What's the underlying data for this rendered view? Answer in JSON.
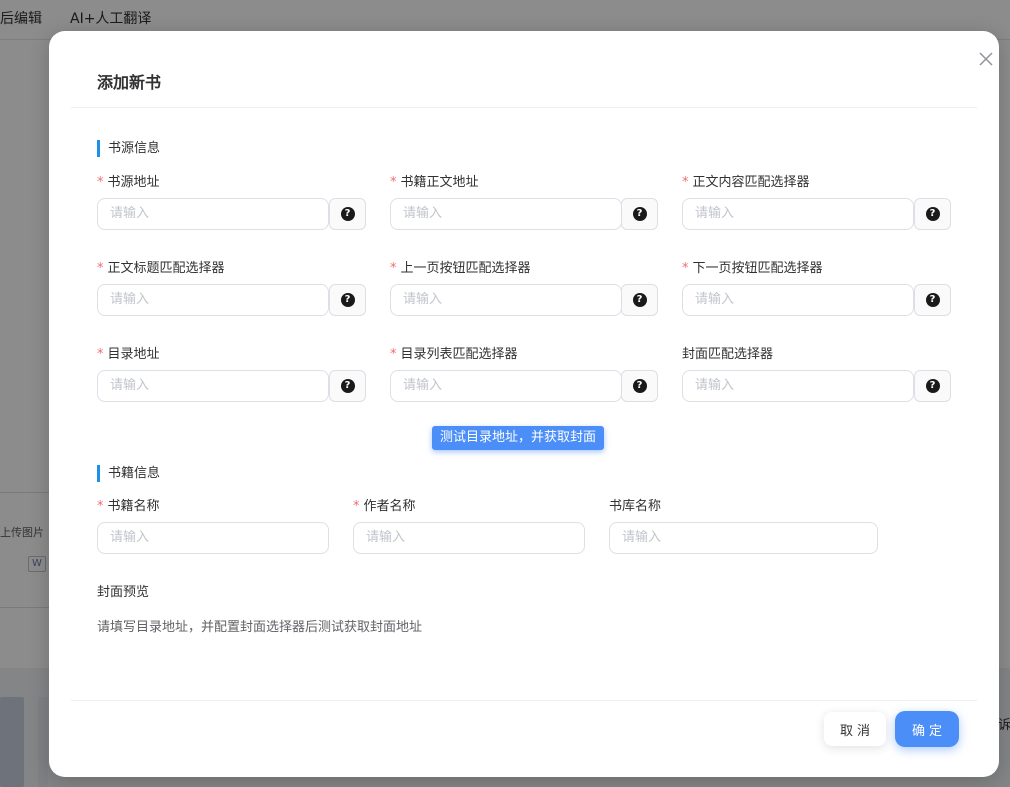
{
  "background": {
    "tabs": [
      "后编辑",
      "AI+人工翻译"
    ],
    "side_text": "上传图片",
    "side_icon": "W",
    "right_text": "诉"
  },
  "dialog": {
    "title": "添加新书",
    "close_icon": "close-icon",
    "source_section": "书源信息",
    "source_fields": [
      {
        "label": "书源地址",
        "required": true,
        "placeholder": "请输入"
      },
      {
        "label": "书籍正文地址",
        "required": true,
        "placeholder": "请输入"
      },
      {
        "label": "正文内容匹配选择器",
        "required": true,
        "placeholder": "请输入"
      },
      {
        "label": "正文标题匹配选择器",
        "required": true,
        "placeholder": "请输入"
      },
      {
        "label": "上一页按钮匹配选择器",
        "required": true,
        "placeholder": "请输入"
      },
      {
        "label": "下一页按钮匹配选择器",
        "required": true,
        "placeholder": "请输入"
      },
      {
        "label": "目录地址",
        "required": true,
        "placeholder": "请输入"
      },
      {
        "label": "目录列表匹配选择器",
        "required": true,
        "placeholder": "请输入"
      },
      {
        "label": "封面匹配选择器",
        "required": false,
        "placeholder": "请输入"
      }
    ],
    "help_glyph": "?",
    "test_button": "测试目录地址，并获取封面",
    "book_section": "书籍信息",
    "book_fields": [
      {
        "label": "书籍名称",
        "required": true,
        "placeholder": "请输入"
      },
      {
        "label": "作者名称",
        "required": true,
        "placeholder": "请输入"
      },
      {
        "label": "书库名称",
        "required": false,
        "placeholder": "请输入"
      }
    ],
    "preview_label": "封面预览",
    "preview_hint": "请填写目录地址，并配置封面选择器后测试获取封面地址",
    "cancel_label": "取消",
    "ok_label": "确定",
    "required_mark": "*",
    "colors": {
      "primary": "#4c8ef7",
      "required": "#f56c6c",
      "section_bar": "#1f8fe8"
    }
  }
}
